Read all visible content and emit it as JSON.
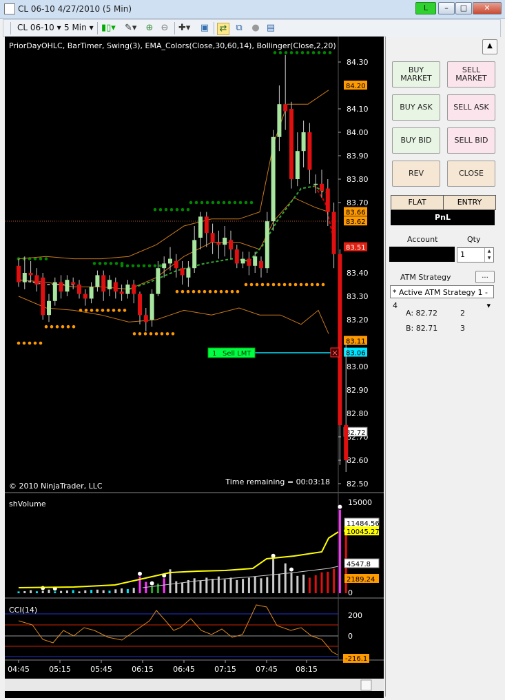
{
  "window": {
    "title": "CL 06-10  4/27/2010 (5 Min)",
    "badge": "L",
    "min": "–",
    "max": "□",
    "close": "✕"
  },
  "toolbar": {
    "instrument": "CL 06-10",
    "interval": "5 Min"
  },
  "chart": {
    "indicators": "PriorDayOHLC, BarTimer, Swing(3), EMA_Colors(Close,30,60,14), Bollinger(Close,2,20)",
    "copyright": "© 2010 NinjaTrader, LLC",
    "timer": "Time remaining = 00:03:18",
    "price_ticks": [
      "84.30",
      "84.10",
      "84.00",
      "83.90",
      "83.80",
      "83.70",
      "83.40",
      "83.30",
      "83.20",
      "83.00",
      "82.90",
      "82.80",
      "82.70",
      "82.60",
      "82.50"
    ],
    "price_markers": [
      {
        "label": "84.20",
        "kind": "orange"
      },
      {
        "label": "83.66",
        "kind": "orange"
      },
      {
        "label": "83.62",
        "kind": "orange"
      },
      {
        "label": "83.51",
        "kind": "red"
      },
      {
        "label": "83.11",
        "kind": "orange"
      },
      {
        "label": "83.06",
        "kind": "cyan"
      },
      {
        "label": "82.72",
        "kind": "white"
      }
    ],
    "order": {
      "qty": "1",
      "label": "Sell LMT",
      "close": "×"
    },
    "volume_panel": {
      "title": "shVolume",
      "ticks": [
        "15000",
        "0"
      ],
      "markers": [
        {
          "label": "11484.56",
          "kind": "white"
        },
        {
          "label": "10045.27",
          "kind": "yellow"
        },
        {
          "label": "4547.8",
          "kind": "white"
        },
        {
          "label": "2189.24",
          "kind": "orange"
        }
      ]
    },
    "cci_panel": {
      "title": "CCI(14)",
      "ticks": [
        "200",
        "0"
      ],
      "marker": "-216.1"
    },
    "time_axis": [
      "04:45",
      "05:15",
      "05:45",
      "06:15",
      "06:45",
      "07:15",
      "07:45",
      "08:15"
    ]
  },
  "panel": {
    "buttons": [
      {
        "label": "BUY MARKET",
        "side": "buy"
      },
      {
        "label": "SELL MARKET",
        "side": "sell"
      },
      {
        "label": "BUY ASK",
        "side": "buy"
      },
      {
        "label": "SELL ASK",
        "side": "sell"
      },
      {
        "label": "BUY BID",
        "side": "buy"
      },
      {
        "label": "SELL BID",
        "side": "sell"
      },
      {
        "label": "REV",
        "side": "neutral"
      },
      {
        "label": "CLOSE",
        "side": "neutral"
      }
    ],
    "tabs": {
      "flat": "FLAT",
      "entry": "ENTRY"
    },
    "pnl": "PnL",
    "account_label": "Account",
    "qty_label": "Qty",
    "qty_value": "1",
    "atm_label": "ATM Strategy",
    "atm_btn": "...",
    "atm_selected": "* Active ATM Strategy 1 - 4",
    "targets": [
      {
        "label": "A: 82.72",
        "qty": "2"
      },
      {
        "label": "B: 82.71",
        "qty": "3"
      }
    ]
  },
  "colors": {
    "buy_bg": "#e8f5e4",
    "sell_bg": "#fbe4ec",
    "neutral_bg": "#f6e6d4",
    "up": "#a8e6a0",
    "down": "#e01010",
    "swing_hi": "#008800",
    "swing_lo": "#ff9900",
    "ema": "#33aa33",
    "bands": "#cc7a1a"
  }
}
